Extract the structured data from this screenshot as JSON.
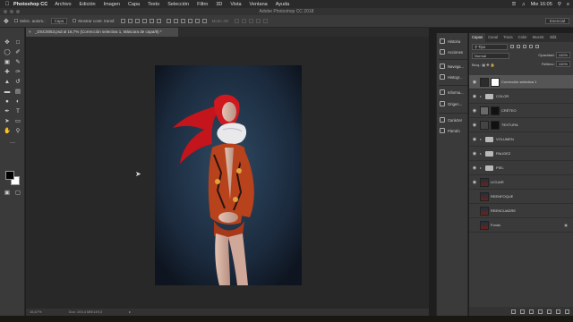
{
  "menubar": {
    "app": "Photoshop CC",
    "items": [
      "Archivo",
      "Edición",
      "Imagen",
      "Capa",
      "Texto",
      "Selección",
      "Filtro",
      "3D",
      "Vista",
      "Ventana",
      "Ayuda"
    ],
    "clock": "Mie 16:05"
  },
  "window": {
    "title": "Adobe Photoshop CC 2018"
  },
  "options": {
    "autoselect_label": "Selec. autom.:",
    "autoselect_value": "Capa",
    "transform_label": "Mostrar contr. transf.",
    "mode3d_label": "Modo 3D:",
    "workspace": "Esencial"
  },
  "document": {
    "tab_title": "_DSC0053.psd al 16,7% (Corrección selectiva 1, Máscara de capa/8) *",
    "zoom": "16,67%",
    "doc_info": "Doc: 103,4 MB/149,3"
  },
  "collapsed_panels": [
    "Historia",
    "Acciones",
    "Navega...",
    "Histogr...",
    "Informa...",
    "Origen...",
    "Carácter",
    "Párrafo"
  ],
  "layers_panel": {
    "tabs": [
      "Capas",
      "Canal",
      "Traza",
      "Color",
      "Muestr.",
      "Bibl."
    ],
    "filter_label": "Tipo",
    "blend_mode": "Normal",
    "opacity_label": "Opacidad:",
    "opacity_value": "100%",
    "lock_label": "Bloq.:",
    "fill_label": "Relleno:",
    "fill_value": "100%",
    "layers": [
      {
        "name": "Corrección selectiva 1",
        "kind": "adjustment",
        "selected": true
      },
      {
        "name": "COLOR",
        "kind": "group"
      },
      {
        "name": "CRÉTEO",
        "kind": "mask"
      },
      {
        "name": "TEXTURA",
        "kind": "mask"
      },
      {
        "name": "VOLUMEN",
        "kind": "group"
      },
      {
        "name": "PALIDEZ",
        "kind": "group"
      },
      {
        "name": "PIEL",
        "kind": "group"
      },
      {
        "name": "LICUAR",
        "kind": "image"
      },
      {
        "name": "REENFOQUE",
        "kind": "image"
      },
      {
        "name": "REENCUADRE",
        "kind": "image"
      },
      {
        "name": "Fondo",
        "kind": "image"
      }
    ]
  },
  "colors": {
    "ui_dark": "#3a3a3a",
    "canvas": "#282828",
    "hair_red": "#c4141c"
  }
}
